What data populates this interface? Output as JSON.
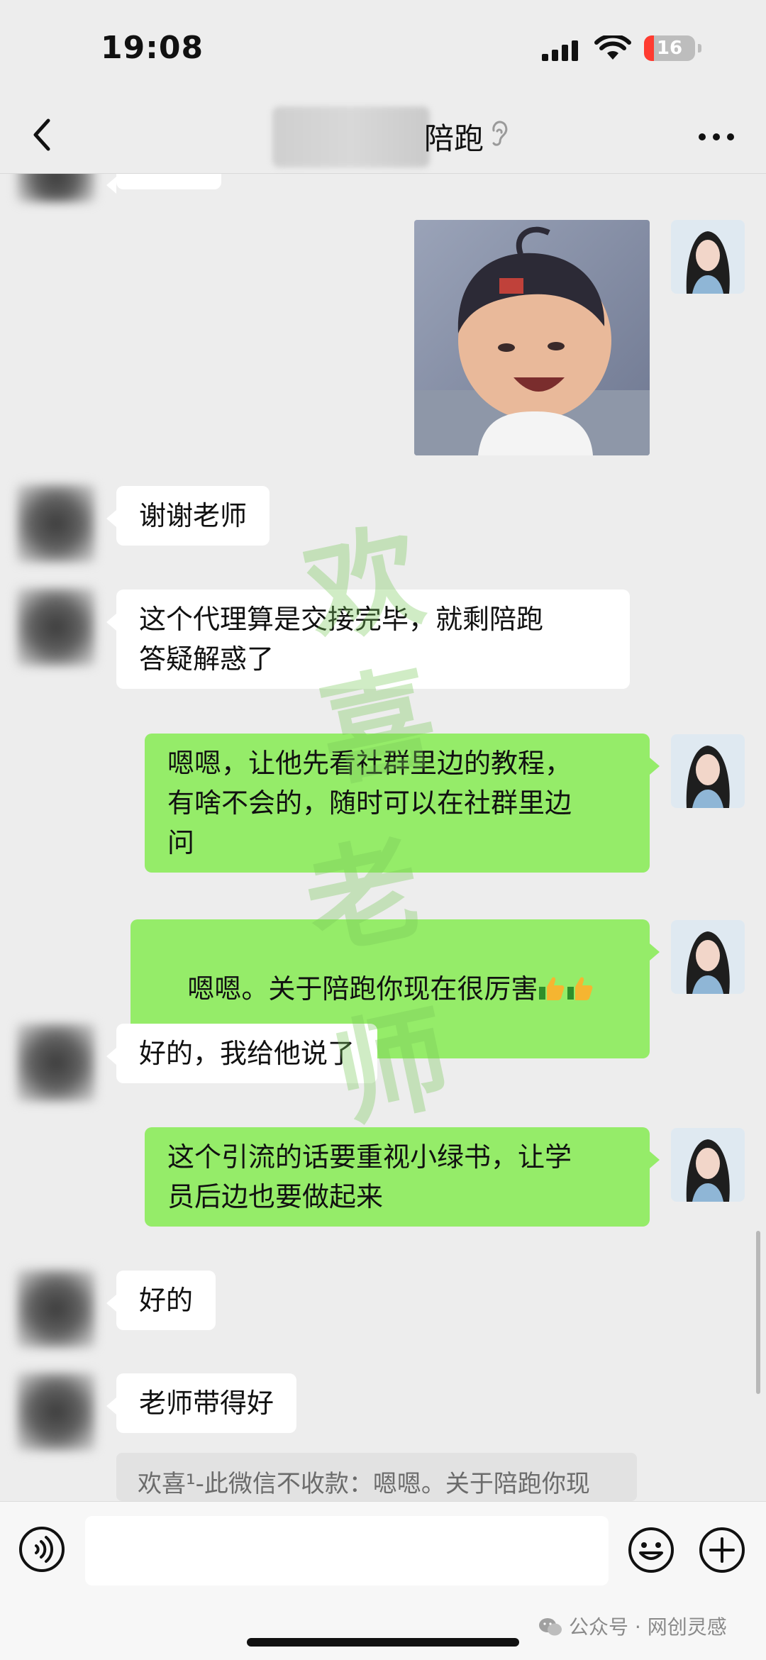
{
  "status_bar": {
    "time": "19:08",
    "battery": "16"
  },
  "header": {
    "title": "陪跑"
  },
  "messages": [
    {
      "side": "left",
      "text": "谢谢老师"
    },
    {
      "side": "left",
      "text": "这个代理算是交接完毕，就剩陪跑\n答疑解惑了"
    },
    {
      "side": "right",
      "text": "嗯嗯，让他先看社群里边的教程，\n有啥不会的，随时可以在社群里边\n问"
    },
    {
      "side": "right",
      "text": "嗯嗯。关于陪跑你现在很厉害"
    },
    {
      "side": "left",
      "text": "好的，我给他说了"
    },
    {
      "side": "right",
      "text": "这个引流的话要重视小绿书，让学\n员后边也要做起来"
    },
    {
      "side": "left",
      "text": "好的"
    },
    {
      "side": "left",
      "text": "老师带得好"
    }
  ],
  "quote": "欢喜¹-此微信不收款：嗯嗯。关于陪跑你现",
  "watermark": [
    "欢",
    "喜",
    "老",
    "师"
  ],
  "footer": {
    "account": "公众号 · 网创灵感"
  },
  "colors": {
    "background": "#ededed",
    "green_bubble": "#95ec69",
    "white_bubble": "#ffffff"
  },
  "icons": [
    "back-icon",
    "ear-icon",
    "more-icon",
    "voice-icon",
    "emoji-icon",
    "plus-icon",
    "thumbs-up-icon",
    "wechat-icon"
  ]
}
